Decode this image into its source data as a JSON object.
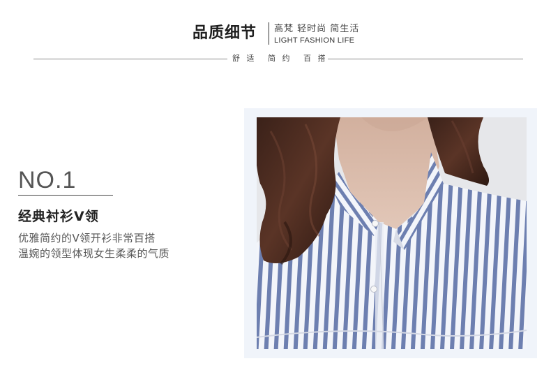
{
  "header": {
    "title": "品质细节",
    "slogan": "高梵 轻时尚 简生活",
    "english": "LIGHT FASHION LIFE",
    "tags": [
      "舒 适",
      "简 约",
      "百 搭"
    ]
  },
  "feature": {
    "number": "NO.1",
    "title": "经典衬衫V领",
    "description": [
      "优雅简约的V领开衫非常百搭",
      "温婉的领型体现女生柔柔的气质"
    ]
  },
  "colors": {
    "frame_bg": "#f0f4fa",
    "stripe_blue": "#6d7fb0",
    "stripe_white": "#f3f5fa",
    "hair": "#4a2a1e",
    "skin": "#d8b8a6"
  }
}
